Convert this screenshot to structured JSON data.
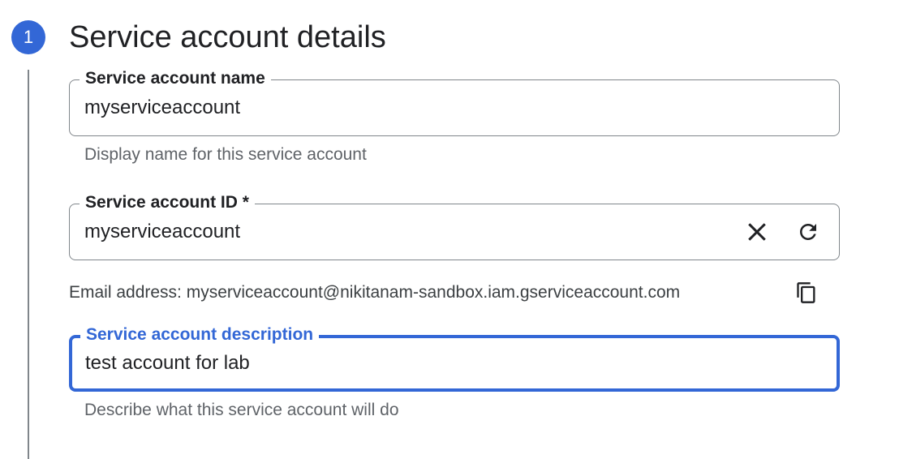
{
  "step": {
    "number": "1",
    "title": "Service account details"
  },
  "fields": {
    "name": {
      "label": "Service account name",
      "value": "myserviceaccount",
      "hint": "Display name for this service account"
    },
    "id": {
      "label": "Service account ID *",
      "value": "myserviceaccount",
      "clear_icon": "close-icon",
      "refresh_icon": "refresh-icon"
    },
    "email": {
      "text": "Email address: myserviceaccount@nikitanam-sandbox.iam.gserviceaccount.com",
      "copy_icon": "copy-icon"
    },
    "description": {
      "label": "Service account description",
      "value": "test account for lab",
      "hint": "Describe what this service account will do"
    }
  },
  "colors": {
    "accent": "#3367d6",
    "border": "#80868b",
    "hint_text": "#5f6368"
  }
}
